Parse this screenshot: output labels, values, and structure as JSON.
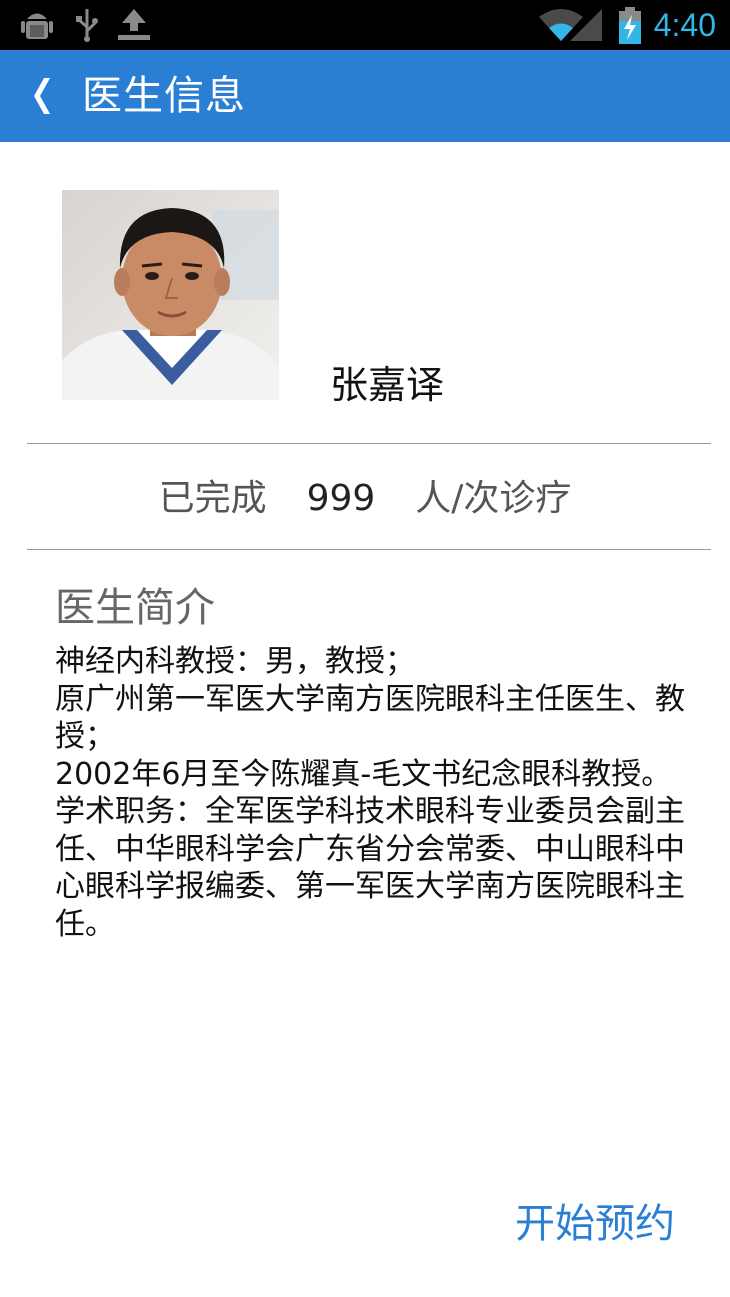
{
  "status_bar": {
    "time": "4:40",
    "time_color": "#33b5e5",
    "icons": [
      "android-debug-icon",
      "usb-icon",
      "upload-icon",
      "wifi-icon",
      "cell-signal-icon",
      "battery-charging-icon"
    ]
  },
  "app_bar": {
    "title": "医生信息",
    "back_icon": "chevron-left-icon",
    "color": "#2a7fd4"
  },
  "doctor": {
    "name": "张嘉译",
    "avatar": "doctor-photo"
  },
  "stats": {
    "prefix": "已完成",
    "count": "999",
    "suffix": "人/次诊疗"
  },
  "intro": {
    "heading": "医生简介",
    "body": "神经内科教授：男，教授；\n原广州第一军医大学南方医院眼科主任医生、教授；\n2002年6月至今陈耀真-毛文书纪念眼科教授。\n学术职务：全军医学科技术眼科专业委员会副主任、中华眼科学会广东省分会常委、中山眼科中心眼科学报编委、第一军医大学南方医院眼科主任。"
  },
  "actions": {
    "book_label": "开始预约"
  }
}
